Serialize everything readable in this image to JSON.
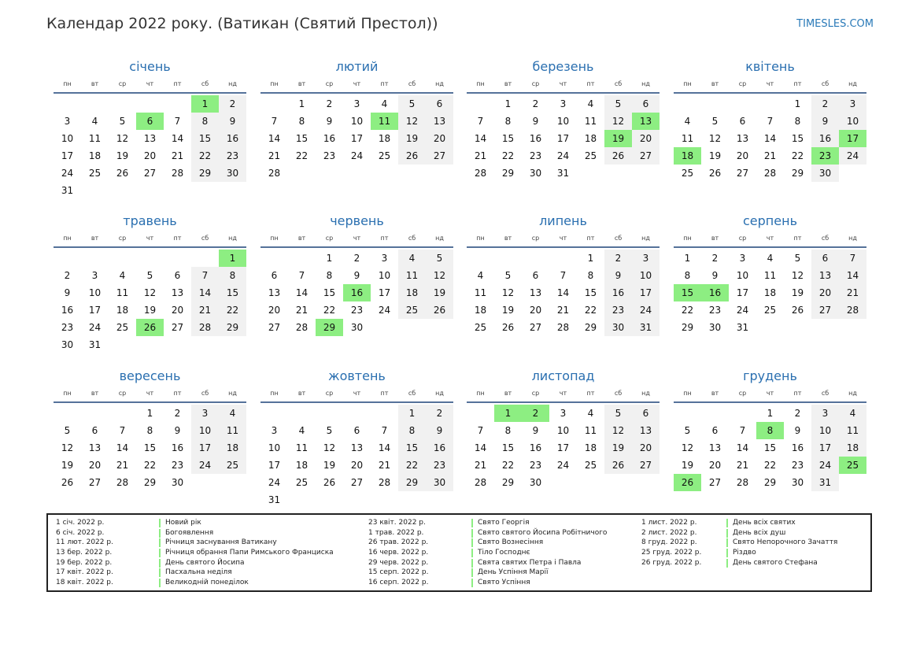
{
  "title": "Календар 2022 року. (Ватикан (Святий Престол))",
  "site": "TIMESLES.COM",
  "weekdays": [
    "пн",
    "вт",
    "ср",
    "чт",
    "пт",
    "сб",
    "нд"
  ],
  "colors": {
    "holiday": "#8dee82",
    "weekend": "#f1f1f1",
    "month_title": "#2a6fb0",
    "rule": "#55729a"
  },
  "months": [
    {
      "name": "січень",
      "start": 5,
      "days": 31,
      "holidays": [
        1,
        6
      ]
    },
    {
      "name": "лютий",
      "start": 1,
      "days": 28,
      "holidays": [
        11
      ]
    },
    {
      "name": "березень",
      "start": 1,
      "days": 31,
      "holidays": [
        13,
        19
      ]
    },
    {
      "name": "квітень",
      "start": 4,
      "days": 30,
      "holidays": [
        17,
        18,
        23
      ]
    },
    {
      "name": "травень",
      "start": 6,
      "days": 31,
      "holidays": [
        1,
        26
      ]
    },
    {
      "name": "червень",
      "start": 2,
      "days": 30,
      "holidays": [
        16,
        29
      ]
    },
    {
      "name": "липень",
      "start": 4,
      "days": 31,
      "holidays": []
    },
    {
      "name": "серпень",
      "start": 0,
      "days": 31,
      "holidays": [
        15,
        16
      ]
    },
    {
      "name": "вересень",
      "start": 3,
      "days": 30,
      "holidays": []
    },
    {
      "name": "жовтень",
      "start": 5,
      "days": 31,
      "holidays": []
    },
    {
      "name": "листопад",
      "start": 1,
      "days": 30,
      "holidays": [
        1,
        2
      ]
    },
    {
      "name": "грудень",
      "start": 3,
      "days": 31,
      "holidays": [
        8,
        25,
        26
      ]
    }
  ],
  "holidays": [
    [
      {
        "date": "1 січ. 2022 р.",
        "name": "Новий рік"
      },
      {
        "date": "6 січ. 2022 р.",
        "name": "Богоявлення"
      },
      {
        "date": "11 лют. 2022 р.",
        "name": "Річниця заснування Ватикану"
      },
      {
        "date": "13 бер. 2022 р.",
        "name": "Річниця обрання Папи Римського Франциска"
      },
      {
        "date": "19 бер. 2022 р.",
        "name": "День святого Йосипа"
      },
      {
        "date": "17 квіт. 2022 р.",
        "name": "Пасхальна неділя"
      },
      {
        "date": "18 квіт. 2022 р.",
        "name": "Великодній понеділок"
      }
    ],
    [
      {
        "date": "23 квіт. 2022 р.",
        "name": "Свято Георгія"
      },
      {
        "date": "1 трав. 2022 р.",
        "name": "Свято святого Йосипа Робітничого"
      },
      {
        "date": "26 трав. 2022 р.",
        "name": "Свято Вознесіння"
      },
      {
        "date": "16 черв. 2022 р.",
        "name": "Тіло Господнє"
      },
      {
        "date": "29 черв. 2022 р.",
        "name": "Свята святих Петра і Павла"
      },
      {
        "date": "15 серп. 2022 р.",
        "name": "День Успіння Марії"
      },
      {
        "date": "16 серп. 2022 р.",
        "name": "Свято Успіння"
      }
    ],
    [
      {
        "date": "1 лист. 2022 р.",
        "name": "День всіх святих"
      },
      {
        "date": "2 лист. 2022 р.",
        "name": "День всіх душ"
      },
      {
        "date": "8 груд. 2022 р.",
        "name": "Свято Непорочного Зачаття"
      },
      {
        "date": "25 груд. 2022 р.",
        "name": "Різдво"
      },
      {
        "date": "26 груд. 2022 р.",
        "name": "День святого Стефана"
      }
    ]
  ]
}
